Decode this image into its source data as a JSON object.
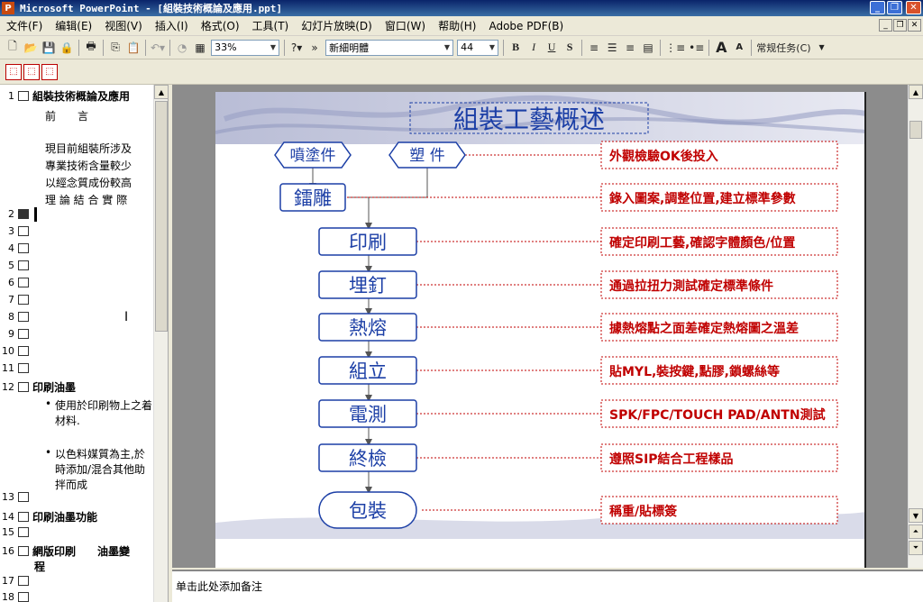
{
  "window": {
    "title": "Microsoft PowerPoint - [組裝技術概論及應用.ppt]",
    "app_icon": "P",
    "buttons": {
      "minimize": "_",
      "maximize": "❐",
      "close": "✕"
    }
  },
  "menu": {
    "items": [
      "文件(F)",
      "编辑(E)",
      "视图(V)",
      "插入(I)",
      "格式(O)",
      "工具(T)",
      "幻灯片放映(D)",
      "窗口(W)",
      "帮助(H)",
      "Adobe PDF(B)"
    ],
    "mdi": {
      "minimize": "_",
      "restore": "❐",
      "close": "✕"
    }
  },
  "toolbar": {
    "zoom": "33%",
    "font_name": "新細明體",
    "font_size": "44",
    "bold": "B",
    "italic": "I",
    "underline": "U",
    "shadow": "S",
    "task_pane": "常规任务(C)",
    "grow_font": "A",
    "shrink_font": "A"
  },
  "outline": {
    "slide1": {
      "num": "1",
      "title": "組裝技術概論及應用",
      "lines": [
        "前　　言",
        "",
        "現目前組裝所涉及",
        "專業技術含量較少",
        "以經念質成份較高",
        "理 論 結 合 實 際"
      ]
    },
    "empty_slides": [
      "2",
      "3",
      "4",
      "5",
      "6",
      "7",
      "8",
      "9",
      "10",
      "11"
    ],
    "slide12": {
      "num": "12",
      "title": "印刷油墨",
      "bullets": [
        "使用於印刷物上之着",
        "材料.",
        "以色料媒質為主,於",
        "時添加/混合其他助",
        "拌而成"
      ]
    },
    "slide13": {
      "num": "13"
    },
    "slide14": {
      "num": "14",
      "title": "印刷油墨功能"
    },
    "slide15": {
      "num": "15"
    },
    "slide16": {
      "num": "16",
      "title": "網版印刷　　油墨變",
      "title2": "程"
    },
    "slide17": {
      "num": "17"
    },
    "slide18": {
      "num": "18"
    }
  },
  "slide": {
    "title": "組裝工藝概述",
    "top_boxes": [
      "噴塗件",
      "塑 件"
    ],
    "steps": [
      "鐳雕",
      "印刷",
      "埋釘",
      "熱熔",
      "組立",
      "電測",
      "終檢",
      "包裝"
    ],
    "notes": [
      "外觀檢驗OK後投入",
      "錄入圖案,調整位置,建立標準參數",
      "確定印刷工藝,確認字體顏色/位置",
      "通過拉扭力測試確定標準條件",
      "據熱熔點之面差確定熱熔圖之溫差",
      "貼MYL,裝按鍵,點膠,鎖螺絲等",
      "SPK/FPC/TOUCH PAD/ANTN測試",
      "遵照SIP結合工程樣品",
      "稱重/貼標簽"
    ]
  },
  "notes_pane": {
    "placeholder": "单击此处添加备注"
  },
  "colors": {
    "flow_blue": "#1c3fa6",
    "note_red": "#c00000",
    "title_bar": "#0a246a"
  }
}
